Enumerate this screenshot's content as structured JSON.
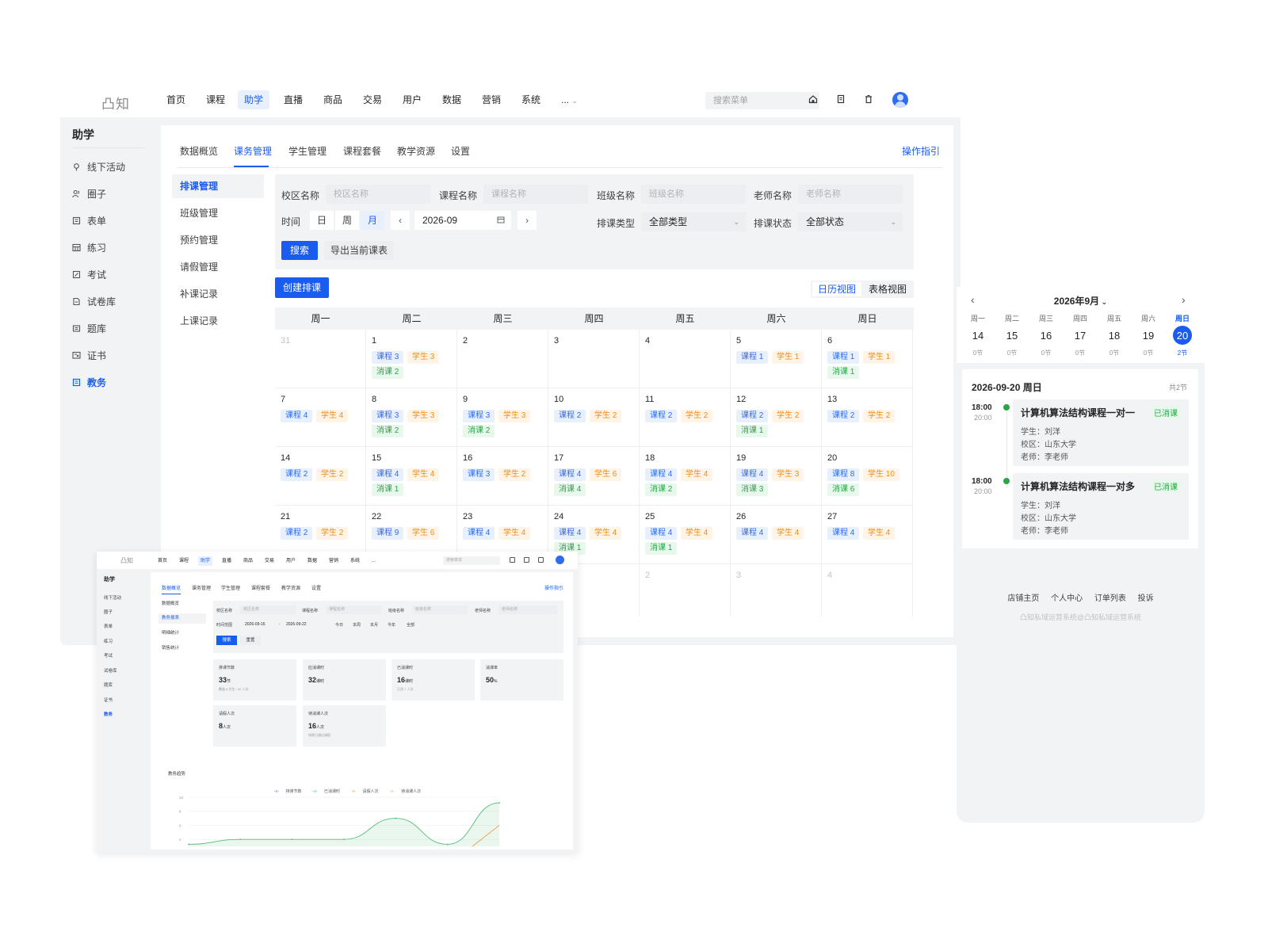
{
  "main": {
    "logo": "凸知",
    "nav": [
      "首页",
      "课程",
      "助学",
      "直播",
      "商品",
      "交易",
      "用户",
      "数据",
      "营销",
      "系统",
      "..."
    ],
    "nav_active": "助学",
    "search_placeholder": "搜索菜单",
    "sidebar": {
      "title": "助学",
      "items": [
        "线下活动",
        "圈子",
        "表单",
        "练习",
        "考试",
        "试卷库",
        "题库",
        "证书",
        "教务"
      ],
      "active": "教务"
    },
    "tabs": [
      "数据概览",
      "课务管理",
      "学生管理",
      "课程套餐",
      "教学资源",
      "设置"
    ],
    "tab_active": "课务管理",
    "guide": "操作指引",
    "subnav": [
      "排课管理",
      "班级管理",
      "预约管理",
      "请假管理",
      "补课记录",
      "上课记录"
    ],
    "subnav_active": "排课管理",
    "filter": {
      "campus_label": "校区名称",
      "campus_placeholder": "校区名称",
      "course_label": "课程名称",
      "course_placeholder": "课程名称",
      "class_label": "班级名称",
      "class_placeholder": "班级名称",
      "teacher_label": "老师名称",
      "teacher_placeholder": "老师名称",
      "time_label": "时间",
      "seg_day": "日",
      "seg_week": "周",
      "seg_month": "月",
      "month_value": "2026-09",
      "type_label": "排课类型",
      "type_value": "全部类型",
      "status_label": "排课状态",
      "status_value": "全部状态",
      "search_btn": "搜索",
      "export_btn": "导出当前课表"
    },
    "create_btn": "创建排课",
    "view_calendar": "日历视图",
    "view_table": "表格视图",
    "weekdays": [
      "周一",
      "周二",
      "周三",
      "周四",
      "周五",
      "周六",
      "周日"
    ],
    "calendar": [
      [
        {
          "day": "31",
          "dim": true,
          "chips": []
        },
        {
          "day": "1",
          "chips": [
            [
              "blue",
              "课程 3"
            ],
            [
              "orange",
              "学生 3"
            ],
            [
              "green",
              "消课 2"
            ]
          ]
        },
        {
          "day": "2",
          "chips": []
        },
        {
          "day": "3",
          "chips": []
        },
        {
          "day": "4",
          "chips": []
        },
        {
          "day": "5",
          "chips": [
            [
              "blue",
              "课程 1"
            ],
            [
              "orange",
              "学生 1"
            ]
          ]
        },
        {
          "day": "6",
          "chips": [
            [
              "blue",
              "课程 1"
            ],
            [
              "orange",
              "学生 1"
            ],
            [
              "green",
              "消课 1"
            ]
          ]
        }
      ],
      [
        {
          "day": "7",
          "chips": [
            [
              "blue",
              "课程 4"
            ],
            [
              "orange",
              "学生 4"
            ]
          ]
        },
        {
          "day": "8",
          "chips": [
            [
              "blue",
              "课程 3"
            ],
            [
              "orange",
              "学生 3"
            ],
            [
              "green",
              "消课 2"
            ]
          ]
        },
        {
          "day": "9",
          "chips": [
            [
              "blue",
              "课程 3"
            ],
            [
              "orange",
              "学生 3"
            ],
            [
              "green",
              "消课 2"
            ]
          ]
        },
        {
          "day": "10",
          "chips": [
            [
              "blue",
              "课程 2"
            ],
            [
              "orange",
              "学生 2"
            ]
          ]
        },
        {
          "day": "11",
          "chips": [
            [
              "blue",
              "课程 2"
            ],
            [
              "orange",
              "学生 2"
            ]
          ]
        },
        {
          "day": "12",
          "chips": [
            [
              "blue",
              "课程 2"
            ],
            [
              "orange",
              "学生 2"
            ],
            [
              "green",
              "消课 1"
            ]
          ]
        },
        {
          "day": "13",
          "chips": [
            [
              "blue",
              "课程 2"
            ],
            [
              "orange",
              "学生 2"
            ]
          ]
        }
      ],
      [
        {
          "day": "14",
          "chips": [
            [
              "blue",
              "课程 2"
            ],
            [
              "orange",
              "学生 2"
            ]
          ]
        },
        {
          "day": "15",
          "chips": [
            [
              "blue",
              "课程 4"
            ],
            [
              "orange",
              "学生 4"
            ],
            [
              "green",
              "消课 1"
            ]
          ]
        },
        {
          "day": "16",
          "chips": [
            [
              "blue",
              "课程 3"
            ],
            [
              "orange",
              "学生 2"
            ]
          ]
        },
        {
          "day": "17",
          "chips": [
            [
              "blue",
              "课程 4"
            ],
            [
              "orange",
              "学生 6"
            ],
            [
              "green",
              "消课 4"
            ]
          ]
        },
        {
          "day": "18",
          "chips": [
            [
              "blue",
              "课程 4"
            ],
            [
              "orange",
              "学生 4"
            ],
            [
              "green",
              "消课 2"
            ]
          ]
        },
        {
          "day": "19",
          "chips": [
            [
              "blue",
              "课程 4"
            ],
            [
              "orange",
              "学生 3"
            ],
            [
              "green",
              "消课 3"
            ]
          ]
        },
        {
          "day": "20",
          "chips": [
            [
              "blue",
              "课程 8"
            ],
            [
              "orange",
              "学生 10"
            ],
            [
              "green",
              "消课 6"
            ]
          ]
        }
      ],
      [
        {
          "day": "21",
          "chips": [
            [
              "blue",
              "课程 2"
            ],
            [
              "orange",
              "学生 2"
            ]
          ]
        },
        {
          "day": "22",
          "chips": [
            [
              "blue",
              "课程 9"
            ],
            [
              "orange",
              "学生 6"
            ]
          ]
        },
        {
          "day": "23",
          "chips": [
            [
              "blue",
              "课程 4"
            ],
            [
              "orange",
              "学生 4"
            ]
          ]
        },
        {
          "day": "24",
          "chips": [
            [
              "blue",
              "课程 4"
            ],
            [
              "orange",
              "学生 4"
            ],
            [
              "green",
              "消课 1"
            ]
          ]
        },
        {
          "day": "25",
          "chips": [
            [
              "blue",
              "课程 4"
            ],
            [
              "orange",
              "学生 4"
            ],
            [
              "green",
              "消课 1"
            ]
          ]
        },
        {
          "day": "26",
          "chips": [
            [
              "blue",
              "课程 4"
            ],
            [
              "orange",
              "学生 4"
            ]
          ]
        },
        {
          "day": "27",
          "chips": [
            [
              "blue",
              "课程 4"
            ],
            [
              "orange",
              "学生 4"
            ]
          ]
        }
      ],
      [
        {
          "day": "",
          "chips": []
        },
        {
          "day": "",
          "chips": []
        },
        {
          "day": "",
          "chips": []
        },
        {
          "day": "",
          "chips": []
        },
        {
          "day": "2",
          "dim": true,
          "chips": []
        },
        {
          "day": "3",
          "dim": true,
          "chips": []
        },
        {
          "day": "4",
          "dim": true,
          "chips": []
        }
      ]
    ]
  },
  "mobile": {
    "month": "2026年9月",
    "weekdays": [
      "周一",
      "周二",
      "周三",
      "周四",
      "周五",
      "周六",
      "周日"
    ],
    "dates": [
      "14",
      "15",
      "16",
      "17",
      "18",
      "19",
      "20"
    ],
    "counts": [
      "0节",
      "0节",
      "0节",
      "0节",
      "0节",
      "0节",
      "2节"
    ],
    "active_index": 6,
    "day_title": "2026-09-20 周日",
    "total": "共2节",
    "lessons": [
      {
        "start": "18:00",
        "end": "20:00",
        "title": "计算机算法结构课程一对一",
        "status": "已消课",
        "student": "学生：刘洋",
        "campus": "校区：山东大学",
        "teacher": "老师：李老师"
      },
      {
        "start": "18:00",
        "end": "20:00",
        "title": "计算机算法结构课程一对多",
        "status": "已消课",
        "student": "学生：刘洋",
        "campus": "校区：山东大学",
        "teacher": "老师：李老师"
      }
    ],
    "links": [
      "店铺主页",
      "个人中心",
      "订单列表",
      "投诉"
    ],
    "copyright": "凸知私域运营系统@凸知私域运营系统"
  },
  "small": {
    "logo": "凸知",
    "nav": [
      "首页",
      "课程",
      "助学",
      "直播",
      "商品",
      "交易",
      "用户",
      "数据",
      "营销",
      "系统",
      "..."
    ],
    "search_placeholder": "搜索菜单",
    "sidebar_title": "助学",
    "sidebar": [
      "线下活动",
      "圈子",
      "表单",
      "练习",
      "考试",
      "试卷库",
      "题库",
      "证书",
      "教务"
    ],
    "tabs": [
      "数据概览",
      "课务管理",
      "学生管理",
      "课程套餐",
      "教学资源",
      "设置"
    ],
    "guide": "操作指引",
    "subnav": [
      "数据概览",
      "教务报表",
      "明细统计",
      "销售统计"
    ],
    "filter": {
      "campus_label": "校区名称",
      "campus_placeholder": "校区名称",
      "course_label": "课程名称",
      "course_placeholder": "课程名称",
      "class_label": "班级名称",
      "class_placeholder": "班级名称",
      "teacher_label": "老师名称",
      "teacher_placeholder": "老师名称",
      "time_label": "时间范围",
      "date_from": "2026-09-16",
      "date_sep": "-",
      "date_to": "2026-09-22",
      "quick": [
        "今日",
        "本周",
        "本月",
        "今年",
        "全部"
      ],
      "search_btn": "搜索",
      "reset_btn": "重置"
    },
    "stats": [
      {
        "label": "排课节数",
        "value": "33",
        "unit": "节",
        "sub": "覆盖 8 学生 / 32 人次"
      },
      {
        "label": "应消课时",
        "value": "32",
        "unit": "课时",
        "sub": ""
      },
      {
        "label": "已消课时",
        "value": "16",
        "unit": "课时",
        "sub": "已消 7 人次"
      },
      {
        "label": "消课率",
        "value": "50",
        "unit": "%",
        "sub": ""
      },
      {
        "label": "请假人次",
        "value": "8",
        "unit": "人次",
        "sub": ""
      },
      {
        "label": "待消课人次",
        "value": "16",
        "unit": "人次",
        "sub": "排除已通过请假"
      }
    ],
    "trend_title": "教务趋势"
  },
  "chart_data": {
    "type": "line",
    "title": "教务趋势",
    "series": [
      {
        "name": "排课节数",
        "color": "#5b7ee5",
        "values": [
          null,
          null,
          null,
          null,
          null,
          null,
          null
        ]
      },
      {
        "name": "已消课时",
        "color": "#52c07a",
        "values": [
          3.3,
          4,
          4,
          4,
          7,
          3.3,
          9.2
        ]
      },
      {
        "name": "请假人次",
        "color": "#f59a4a",
        "values": [
          null,
          null,
          null,
          null,
          null,
          null,
          6
        ]
      },
      {
        "name": "待消课人次",
        "color": "#f0b46a",
        "values": [
          null,
          null,
          null,
          null,
          null,
          null,
          null
        ]
      }
    ],
    "ylim": [
      3,
      10
    ],
    "yticks": [
      4,
      6,
      8,
      10
    ],
    "grid": true,
    "legend": "top"
  },
  "icons": {
    "top": [
      "home-icon",
      "document-icon",
      "trash-icon"
    ],
    "sidebar": [
      "pin-icon",
      "people-icon",
      "form-icon",
      "grid-icon",
      "edit-icon",
      "file-icon",
      "list-icon",
      "certificate-icon",
      "schedule-icon"
    ]
  },
  "colors": {
    "primary": "#1a5cf0",
    "blue_chip": "#2f6bf0",
    "orange_chip": "#f08c1a",
    "green_chip": "#2ba44a"
  }
}
